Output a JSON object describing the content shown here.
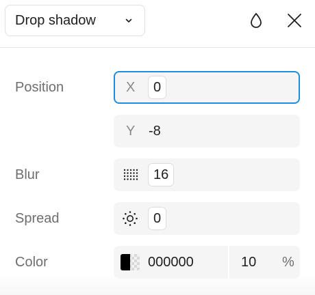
{
  "header": {
    "effect_type": "Drop shadow",
    "icons": [
      "chevron-down-icon",
      "droplet-icon",
      "close-icon"
    ]
  },
  "position": {
    "label": "Position",
    "x": {
      "prefix": "X",
      "value": "0"
    },
    "y": {
      "prefix": "Y",
      "value": "-8"
    }
  },
  "blur": {
    "label": "Blur",
    "value": "16",
    "icon": "blur-dots-icon"
  },
  "spread": {
    "label": "Spread",
    "value": "0",
    "icon": "spread-sun-icon"
  },
  "color": {
    "label": "Color",
    "hex": "000000",
    "opacity": "10",
    "opacity_unit": "%",
    "swatch_color": "#000000"
  },
  "colors": {
    "accent": "#1e8ddb",
    "field_bg": "#f5f5f5"
  }
}
